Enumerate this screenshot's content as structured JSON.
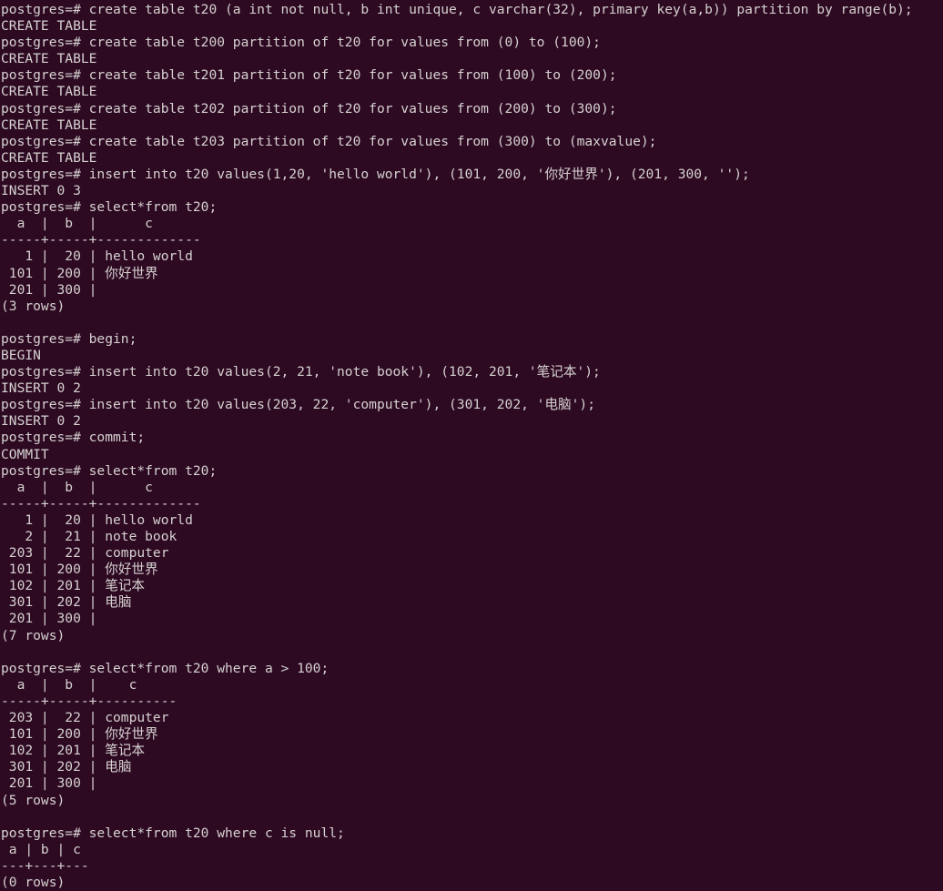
{
  "terminal": {
    "app": "psql",
    "prompt": "postgres=#",
    "colors": {
      "background": "#2d0922",
      "foreground": "#d6d2d0"
    },
    "lines": [
      "postgres=# create table t20 (a int not null, b int unique, c varchar(32), primary key(a,b)) partition by range(b);",
      "CREATE TABLE",
      "postgres=# create table t200 partition of t20 for values from (0) to (100);",
      "CREATE TABLE",
      "postgres=# create table t201 partition of t20 for values from (100) to (200);",
      "CREATE TABLE",
      "postgres=# create table t202 partition of t20 for values from (200) to (300);",
      "CREATE TABLE",
      "postgres=# create table t203 partition of t20 for values from (300) to (maxvalue);",
      "CREATE TABLE",
      "postgres=# insert into t20 values(1,20, 'hello world'), (101, 200, '你好世界'), (201, 300, '');",
      "INSERT 0 3",
      "postgres=# select*from t20;",
      "  a  |  b  |      c",
      "-----+-----+-------------",
      "   1 |  20 | hello world",
      " 101 | 200 | 你好世界",
      " 201 | 300 |",
      "(3 rows)",
      "",
      "postgres=# begin;",
      "BEGIN",
      "postgres=# insert into t20 values(2, 21, 'note book'), (102, 201, '笔记本');",
      "INSERT 0 2",
      "postgres=# insert into t20 values(203, 22, 'computer'), (301, 202, '电脑');",
      "INSERT 0 2",
      "postgres=# commit;",
      "COMMIT",
      "postgres=# select*from t20;",
      "  a  |  b  |      c",
      "-----+-----+-------------",
      "   1 |  20 | hello world",
      "   2 |  21 | note book",
      " 203 |  22 | computer",
      " 101 | 200 | 你好世界",
      " 102 | 201 | 笔记本",
      " 301 | 202 | 电脑",
      " 201 | 300 |",
      "(7 rows)",
      "",
      "postgres=# select*from t20 where a > 100;",
      "  a  |  b  |    c",
      "-----+-----+----------",
      " 203 |  22 | computer",
      " 101 | 200 | 你好世界",
      " 102 | 201 | 笔记本",
      " 301 | 202 | 电脑",
      " 201 | 300 |",
      "(5 rows)",
      "",
      "postgres=# select*from t20 where c is null;",
      " a | b | c",
      "---+---+---",
      "(0 rows)"
    ]
  }
}
